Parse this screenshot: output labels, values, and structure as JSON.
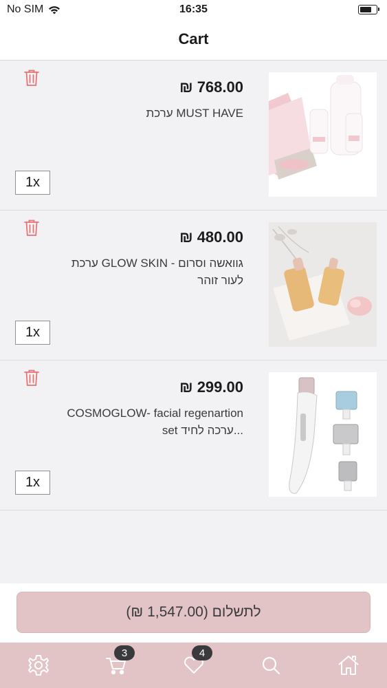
{
  "status_bar": {
    "carrier": "No SIM",
    "time": "16:35"
  },
  "nav": {
    "title": "Cart"
  },
  "items": [
    {
      "price": "₪ 768.00",
      "name": "ערכת MUST HAVE",
      "quantity": "1x",
      "image": "must-have-kit-image"
    },
    {
      "price": "₪ 480.00",
      "name": "ערכת GLOW SKIN - גוואשה וסרום לעור זוהר",
      "quantity": "1x",
      "image": "glow-skin-kit-image"
    },
    {
      "price": "₪ 299.00",
      "name": "COSMOGLOW- facial regenartion set ערכה לחיד...",
      "quantity": "1x",
      "image": "cosmoglow-roller-image"
    }
  ],
  "checkout": {
    "label": "לתשלום (1,547.00 ₪)"
  },
  "tabs": {
    "settings": {
      "icon": "gear-icon"
    },
    "cart": {
      "icon": "cart-icon",
      "badge": "3"
    },
    "wishlist": {
      "icon": "heart-icon",
      "badge": "4"
    },
    "search": {
      "icon": "search-icon"
    },
    "home": {
      "icon": "home-icon"
    }
  },
  "colors": {
    "accent": "#e3c4c6",
    "trash": "#e57373",
    "badge": "#3a3a3c"
  }
}
